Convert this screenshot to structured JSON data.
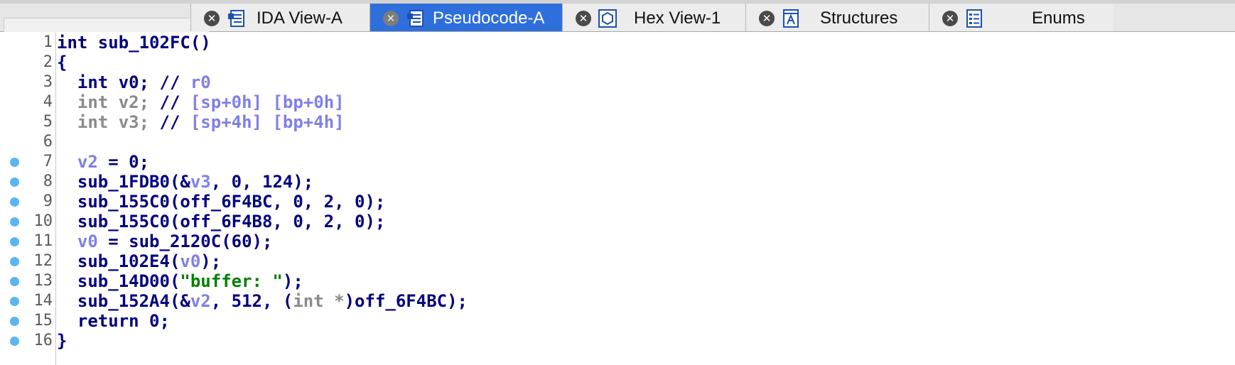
{
  "tabs": [
    {
      "label": "IDA View-A",
      "icon": "ida-view-icon",
      "active": false
    },
    {
      "label": "Pseudocode-A",
      "icon": "pseudocode-icon",
      "active": true
    },
    {
      "label": "Hex View-1",
      "icon": "hex-view-icon",
      "active": false
    },
    {
      "label": "Structures",
      "icon": "structures-icon",
      "active": false
    },
    {
      "label": "Enums",
      "icon": "enums-icon",
      "active": false
    }
  ],
  "tab_close_glyph": "✕",
  "colors": {
    "active_tab": "#2f6fdc",
    "keyword": "#000080",
    "variable": "#7f7fe8",
    "comment": "#8a8a8a",
    "string": "#008000",
    "breakpoint": "#5bb6ee"
  },
  "code_lines": [
    {
      "n": "1",
      "bp": false,
      "tokens": [
        [
          "plain",
          "int sub_102FC()"
        ]
      ]
    },
    {
      "n": "2",
      "bp": false,
      "tokens": [
        [
          "plain",
          "{"
        ]
      ]
    },
    {
      "n": "3",
      "bp": false,
      "tokens": [
        [
          "plain",
          "  int v0; // "
        ],
        [
          "var",
          "r0"
        ]
      ]
    },
    {
      "n": "4",
      "bp": false,
      "tokens": [
        [
          "gray",
          "  int v2; "
        ],
        [
          "plain",
          "// "
        ],
        [
          "var",
          "[sp+0h] [bp+0h]"
        ]
      ]
    },
    {
      "n": "5",
      "bp": false,
      "tokens": [
        [
          "gray",
          "  int v3; "
        ],
        [
          "plain",
          "// "
        ],
        [
          "var",
          "[sp+4h] [bp+4h]"
        ]
      ]
    },
    {
      "n": "6",
      "bp": false,
      "tokens": [
        [
          "plain",
          ""
        ]
      ]
    },
    {
      "n": "7",
      "bp": true,
      "tokens": [
        [
          "plain",
          "  "
        ],
        [
          "var",
          "v2"
        ],
        [
          "plain",
          " = 0;"
        ]
      ]
    },
    {
      "n": "8",
      "bp": true,
      "tokens": [
        [
          "plain",
          "  sub_1FDB0(&"
        ],
        [
          "var",
          "v3"
        ],
        [
          "plain",
          ", 0, 124);"
        ]
      ]
    },
    {
      "n": "9",
      "bp": true,
      "tokens": [
        [
          "plain",
          "  sub_155C0(off_6F4BC, 0, 2, 0);"
        ]
      ]
    },
    {
      "n": "10",
      "bp": true,
      "tokens": [
        [
          "plain",
          "  sub_155C0(off_6F4B8, 0, 2, 0);"
        ]
      ]
    },
    {
      "n": "11",
      "bp": true,
      "tokens": [
        [
          "plain",
          "  "
        ],
        [
          "var",
          "v0"
        ],
        [
          "plain",
          " = sub_2120C(60);"
        ]
      ]
    },
    {
      "n": "12",
      "bp": true,
      "tokens": [
        [
          "plain",
          "  sub_102E4("
        ],
        [
          "var",
          "v0"
        ],
        [
          "plain",
          ");"
        ]
      ]
    },
    {
      "n": "13",
      "bp": true,
      "tokens": [
        [
          "plain",
          "  sub_14D00("
        ],
        [
          "str",
          "\"buffer: \""
        ],
        [
          "plain",
          ");"
        ]
      ]
    },
    {
      "n": "14",
      "bp": true,
      "tokens": [
        [
          "plain",
          "  sub_152A4(&"
        ],
        [
          "var",
          "v2"
        ],
        [
          "plain",
          ", 512, ("
        ],
        [
          "gray",
          "int *"
        ],
        [
          "plain",
          ")off_6F4BC);"
        ]
      ]
    },
    {
      "n": "15",
      "bp": true,
      "tokens": [
        [
          "plain",
          "  return 0;"
        ]
      ]
    },
    {
      "n": "16",
      "bp": true,
      "tokens": [
        [
          "plain",
          "}"
        ]
      ]
    }
  ]
}
